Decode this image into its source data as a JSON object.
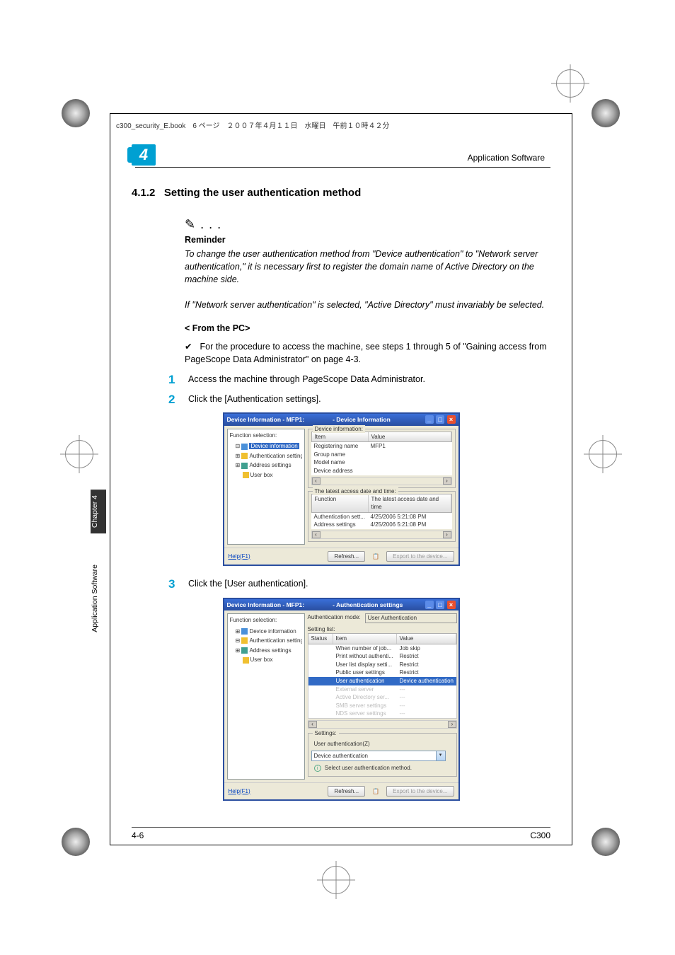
{
  "crop_header": "c300_security_E.book　6 ページ　２００７年４月１１日　水曜日　午前１０時４２分",
  "running_head": "Application Software",
  "chapter_num": "4",
  "section_number": "4.1.2",
  "section_title": "Setting the user authentication method",
  "reminder_dots": "✎ . . .",
  "reminder_label": "Reminder",
  "reminder_para1": "To change the user authentication method from \"Device authentication\" to \"Network server authentication,\" it is necessary first to register the domain name of Active Directory on the machine side.",
  "reminder_para2": "If \"Network server authentication\" is selected, \"Active Directory\" must invariably be selected.",
  "from_pc": "< From the PC>",
  "checkmark": "✔",
  "check_text": "For the procedure to access the machine, see steps 1 through 5 of \"Gaining access from PageScope Data Administrator\" on page 4-3.",
  "step1_num": "1",
  "step1_text": "Access the machine through PageScope Data Administrator.",
  "step2_num": "2",
  "step2_text": "Click the [Authentication settings].",
  "step3_num": "3",
  "step3_text": "Click the [User authentication].",
  "sidetab_dark": "Chapter 4",
  "sidetab_light": "Application Software",
  "footer_left": "4-6",
  "footer_right": "C300",
  "ss1": {
    "title_left": "Device Information - MFP1:",
    "title_center": "- Device Information",
    "func_sel": "Function selection:",
    "tree": {
      "devinfo": "Device information",
      "auth": "Authentication settings",
      "addr": "Address settings",
      "userbox": "User box"
    },
    "group1_title": "Device information:",
    "col_item": "Item",
    "col_value": "Value",
    "rows": [
      {
        "item": "Registering name",
        "value": "MFP1"
      },
      {
        "item": "Group name",
        "value": ""
      },
      {
        "item": "Model name",
        "value": ""
      },
      {
        "item": "Device address",
        "value": ""
      }
    ],
    "group2_title": "The latest access date and time:",
    "col_func": "Function",
    "col_date": "The latest access date and time",
    "rows2": [
      {
        "f": "Authentication sett...",
        "d": "4/25/2006 5:21:08 PM"
      },
      {
        "f": "Address settings",
        "d": "4/25/2006 5:21:08 PM"
      }
    ],
    "help": "Help(F1)",
    "refresh": "Refresh...",
    "export": "Export to the device..."
  },
  "ss2": {
    "title_left": "Device Information - MFP1:",
    "title_center": "- Authentication settings",
    "func_sel": "Function selection:",
    "tree": {
      "devinfo": "Device information",
      "auth": "Authentication settings",
      "addr": "Address settings",
      "userbox": "User box"
    },
    "auth_mode_label": "Authentication mode:",
    "auth_mode_value": "User Authentication",
    "setting_list": "Setting list:",
    "col_status": "Status",
    "col_item": "Item",
    "col_value": "Value",
    "rows": [
      {
        "s": "",
        "i": "When number of job...",
        "v": "Job skip"
      },
      {
        "s": "",
        "i": "Print without authenti...",
        "v": "Restrict"
      },
      {
        "s": "",
        "i": "User list display setti...",
        "v": "Restrict"
      },
      {
        "s": "",
        "i": "Public user settings",
        "v": "Restrict"
      }
    ],
    "hlrow": {
      "s": "",
      "i": "User authentication",
      "v": "Device authentication"
    },
    "disrows": [
      {
        "s": "",
        "i": "External server",
        "v": "---"
      },
      {
        "s": "",
        "i": "Active Directory ser...",
        "v": "---"
      },
      {
        "s": "",
        "i": "SMB server settings",
        "v": "---"
      },
      {
        "s": "",
        "i": "NDS server settings",
        "v": "---"
      }
    ],
    "settings_label": "Settings:",
    "user_auth_z": "User authentication(Z)",
    "dd_value": "Device authentication",
    "hint": "Select user authentication method.",
    "help": "Help(F1)",
    "refresh": "Refresh...",
    "export": "Export to the device..."
  }
}
